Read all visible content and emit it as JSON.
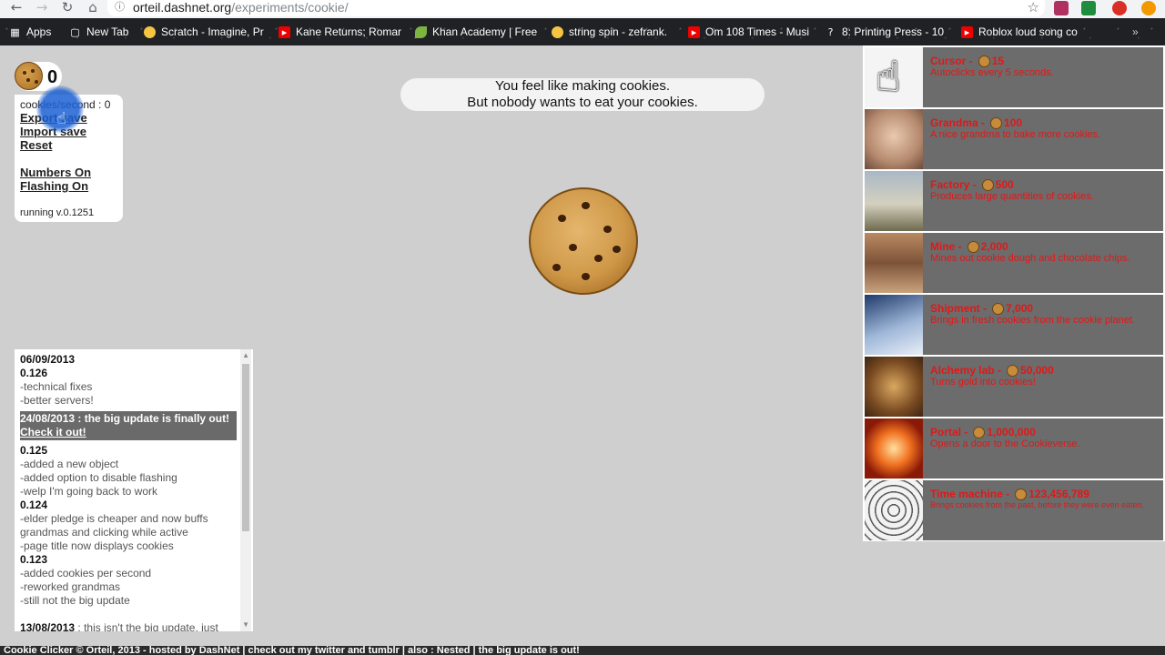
{
  "browser": {
    "url_host": "orteil.dashnet.org",
    "url_path": "/experiments/cookie/",
    "bookmarks": [
      "Apps",
      "New Tab",
      "Scratch - Imagine, Pr",
      "Kane Returns; Romar",
      "Khan Academy | Free",
      "string spin - zefrank.",
      "Om 108 Times - Musi",
      "8: Printing Press - 10",
      "Roblox loud song co"
    ]
  },
  "game": {
    "cookies": "0",
    "cps": "cookies/second : 0",
    "menu": [
      "Export save",
      "Import save",
      "Reset"
    ],
    "options": [
      "Numbers On",
      "Flashing On"
    ],
    "version": "running v.0.1251",
    "message_line1": "You feel like making cookies.",
    "message_line2": "But nobody wants to eat your cookies."
  },
  "changelog": {
    "date1": "06/09/2013",
    "v126": "0.126",
    "v126_notes": [
      "-technical fixes",
      "-better servers!"
    ],
    "highlight_line1": "24/08/2013 : the big update is finally out!",
    "highlight_line2": "Check it out!",
    "v125": "0.125",
    "v125_notes": [
      "-added a new object",
      "-added option to disable flashing",
      "-welp I'm going back to work"
    ],
    "v124": "0.124",
    "v124_notes": [
      "-elder pledge is cheaper and now buffs",
      "grandmas and clicking while active",
      "-page title now displays cookies"
    ],
    "v123": "0.123",
    "v123_notes": [
      "-added cookies per second",
      "-reworked grandmas",
      "-still not the big update"
    ],
    "last_date": "13/08/2013",
    "last_note": " : this isn't the big update, just"
  },
  "store": [
    {
      "name": "Cursor",
      "price": "15",
      "desc": "Autoclicks every 5 seconds."
    },
    {
      "name": "Grandma",
      "price": "100",
      "desc": "A nice grandma to bake more cookies."
    },
    {
      "name": "Factory",
      "price": "500",
      "desc": "Produces large quantities of cookies."
    },
    {
      "name": "Mine",
      "price": "2,000",
      "desc": "Mines out cookie dough and chocolate chips."
    },
    {
      "name": "Shipment",
      "price": "7,000",
      "desc": "Brings in fresh cookies from the cookie planet."
    },
    {
      "name": "Alchemy lab",
      "price": "50,000",
      "desc": "Turns gold into cookies!"
    },
    {
      "name": "Portal",
      "price": "1,000,000",
      "desc": "Opens a door to the Cookieverse."
    },
    {
      "name": "Time machine",
      "price": "123,456,789",
      "desc": "Brings cookies from the past, before they were even eaten."
    }
  ],
  "footer": "Cookie Clicker © Orteil, 2013 - hosted by DashNet | check out my twitter and tumblr | also : Nested | the big update is out!"
}
